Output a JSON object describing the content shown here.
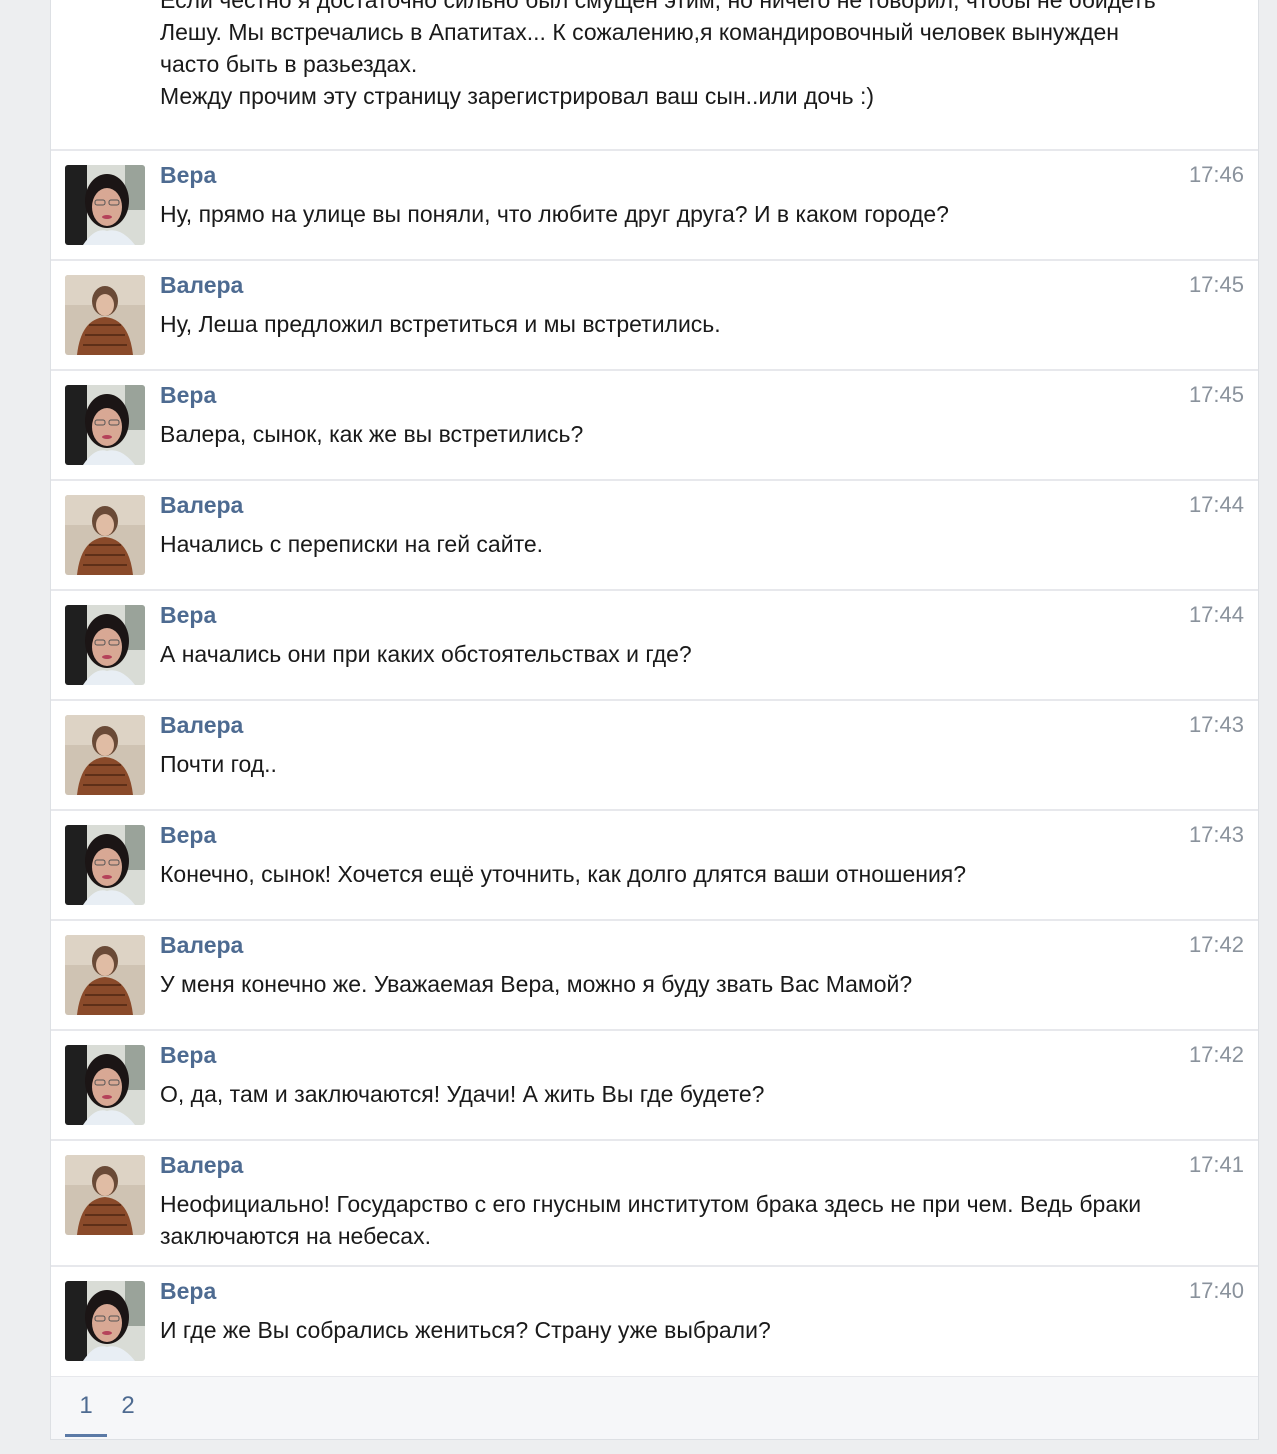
{
  "partial_message": {
    "lines": [
      "Если честно я достаточно сильно был смущен этим, но ничего не говорил, чтобы не обидеть",
      "Лешу. Мы встречались в Апатитах... К сожалению,я командировочный человек вынужден",
      "часто быть в разьездах.",
      "Между прочим эту страницу зарегистрировал ваш сын..или дочь :)"
    ]
  },
  "messages": [
    {
      "author": "Вера",
      "time": "17:46",
      "text": "Ну, прямо на улице вы поняли, что любите друг друга? И в каком городе?"
    },
    {
      "author": "Валера",
      "time": "17:45",
      "text": "Ну, Леша предложил встретиться и мы встретились."
    },
    {
      "author": "Вера",
      "time": "17:45",
      "text": "Валера, сынок, как же вы встретились?"
    },
    {
      "author": "Валера",
      "time": "17:44",
      "text": "Начались с переписки на гей сайте."
    },
    {
      "author": "Вера",
      "time": "17:44",
      "text": "А начались они при каких обстоятельствах и где?"
    },
    {
      "author": "Валера",
      "time": "17:43",
      "text": "Почти год.."
    },
    {
      "author": "Вера",
      "time": "17:43",
      "text": "Конечно, сынок! Хочется ещё уточнить, как долго длятся ваши отношения?"
    },
    {
      "author": "Валера",
      "time": "17:42",
      "text": "У меня конечно же. Уважаемая Вера, можно я буду звать Вас Мамой?"
    },
    {
      "author": "Вера",
      "time": "17:42",
      "text": "О, да, там и заключаются! Удачи! А жить Вы где будете?"
    },
    {
      "author": "Валера",
      "time": "17:41",
      "text": "Неофициально! Государство с его гнусным институтом брака здесь не при чем. Ведь браки заключаются на небесах."
    },
    {
      "author": "Вера",
      "time": "17:40",
      "text": "И где же Вы собрались жениться? Страну уже выбрали?"
    }
  ],
  "pagination": {
    "pages": [
      "1",
      "2"
    ],
    "active": "1"
  },
  "colors": {
    "author": "#4e6b91",
    "time": "#8a929c",
    "divider": "#e7e8ec",
    "background": "#edeef0",
    "active_page_underline": "#5b7aa6"
  }
}
